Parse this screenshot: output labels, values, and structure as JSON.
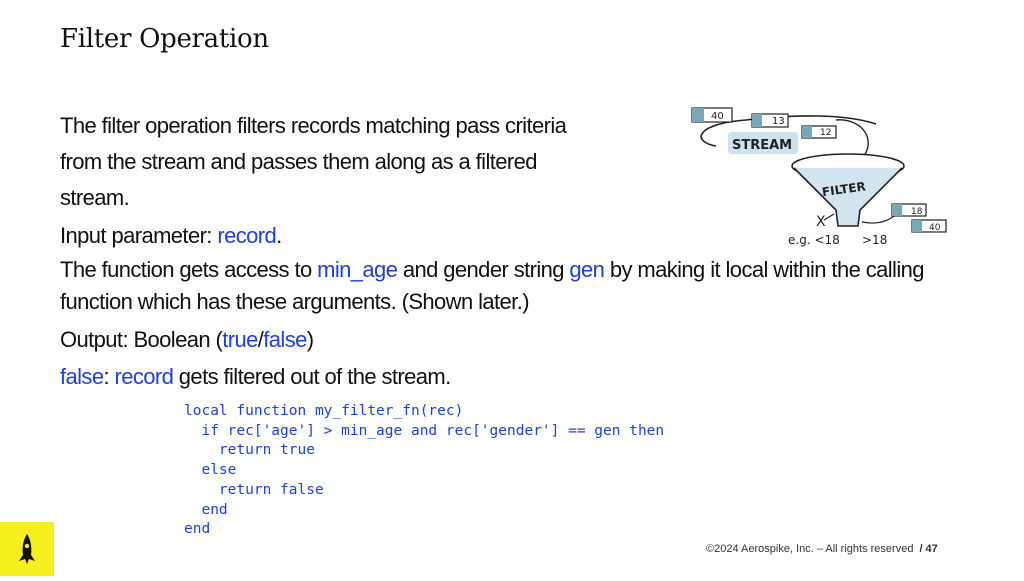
{
  "slide": {
    "title": "Filter Operation",
    "paragraph1": "The filter operation filters records matching pass criteria from the stream and passes them along as a filtered stream.",
    "input_label": "Input parameter: ",
    "input_value": "record",
    "input_end": ".",
    "func_pre": "The function gets access to ",
    "func_var1": "min_age",
    "func_mid": " and gender string ",
    "func_var2": "gen",
    "func_post": " by making it local within the calling function which has these arguments. (Shown later.)",
    "output_label": "Output: Boolean (",
    "output_true": "true",
    "output_sep": "/",
    "output_false": "false",
    "output_end": ")",
    "false_word": "false",
    "false_colon": ": ",
    "false_record": "record",
    "false_rest": " gets filtered out of the stream."
  },
  "code": {
    "lines": [
      "local function my_filter_fn(rec)",
      "  if rec['age'] > min_age and rec['gender'] == gen then",
      "    return true",
      "  else",
      "    return false",
      "  end",
      "end"
    ]
  },
  "illustration": {
    "stream_label": "STREAM",
    "filter_label": "FILTER",
    "record_values": [
      "40",
      "13",
      "12"
    ],
    "output_values": [
      "18",
      "40"
    ],
    "reject_mark": "X",
    "example_label": "e.g. <18",
    "pass_label": ">18"
  },
  "footer": {
    "copyright": "©2024 Aerospike, Inc. – All rights reserved",
    "page": "/ 47"
  },
  "colors": {
    "accent_blue": "#1f3fe0",
    "logo_yellow": "#f6ee1e",
    "sketch_teal": "#7aa7b8"
  },
  "icons": {
    "logo": "rocket-icon"
  }
}
